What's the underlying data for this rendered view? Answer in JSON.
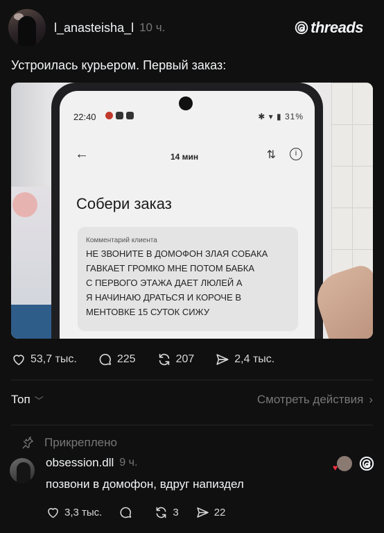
{
  "header": {
    "username": "l_anasteisha_l",
    "time": "10 ч.",
    "logo": "threads"
  },
  "post": {
    "text": "Устроилась курьером. Первый заказ:",
    "image": {
      "status_time": "22:40",
      "status_right": "31%",
      "eta": "14 мин",
      "title": "Собери заказ",
      "comment_label": "Комментарий клиента",
      "comment_text": "НЕ ЗВОНИТЕ В ДОМОФОН ЗЛАЯ СОБАКА\nГАВКАЕТ ГРОМКО МНЕ ПОТОМ БАБКА\nС ПЕРВОГО ЭТАЖА ДАЕТ ЛЮЛЕЙ А\nЯ НАЧИНАЮ ДРАТЬСЯ И КОРОЧЕ В\nМЕНТОВКЕ 15 СУТОК СИЖУ"
    },
    "actions": {
      "likes": "53,7 тыс.",
      "replies": "225",
      "reposts": "207",
      "shares": "2,4 тыс."
    }
  },
  "sort": {
    "label": "Топ",
    "view_activity": "Смотреть действия"
  },
  "pinned_label": "Прикреплено",
  "comment": {
    "username": "obsession.dll",
    "time": "9 ч.",
    "text": "позвони в домофон, вдруг напиздел",
    "actions": {
      "likes": "3,3 тыс.",
      "replies": "",
      "reposts": "3",
      "shares": "22"
    }
  },
  "icons": [
    "heart-icon",
    "comment-icon",
    "repost-icon",
    "share-icon",
    "pin-icon",
    "threads-logo-icon",
    "chevron-down-icon",
    "chevron-right-icon"
  ],
  "colors": {
    "background": "#101010",
    "text": "#f3f5f7",
    "muted": "#777777",
    "like_red": "#ff3040"
  }
}
